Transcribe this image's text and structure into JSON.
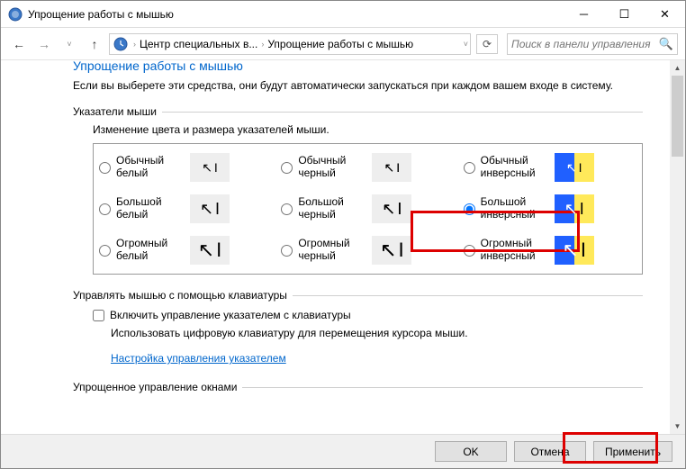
{
  "window": {
    "title": "Упрощение работы с мышью"
  },
  "nav": {
    "crumb1": "Центр специальных в...",
    "crumb2": "Упрощение работы с мышью",
    "search_placeholder": "Поиск в панели управления"
  },
  "page": {
    "heading": "Упрощение работы с мышью",
    "description": "Если вы выберете эти средства, они будут автоматически запускаться при каждом вашем входе в систему."
  },
  "pointers": {
    "section_title": "Указатели мыши",
    "subtitle": "Изменение цвета и размера указателей мыши.",
    "options": {
      "white_normal": "Обычный белый",
      "black_normal": "Обычный черный",
      "inv_normal": "Обычный инверсный",
      "white_large": "Большой белый",
      "black_large": "Большой черный",
      "inv_large": "Большой инверсный",
      "white_huge": "Огромный белый",
      "black_huge": "Огромный черный",
      "inv_huge": "Огромный инверсный"
    },
    "selected": "inv_large"
  },
  "keyboard_mouse": {
    "section_title": "Управлять мышью с помощью клавиатуры",
    "checkbox_label": "Включить управление указателем с клавиатуры",
    "checkbox_checked": false,
    "help_text": "Использовать цифровую клавиатуру для перемещения курсора мыши.",
    "link_text": "Настройка управления указателем"
  },
  "windows_mgmt": {
    "section_title": "Упрощенное управление окнами"
  },
  "buttons": {
    "ok": "OK",
    "cancel": "Отмена",
    "apply": "Применить"
  }
}
